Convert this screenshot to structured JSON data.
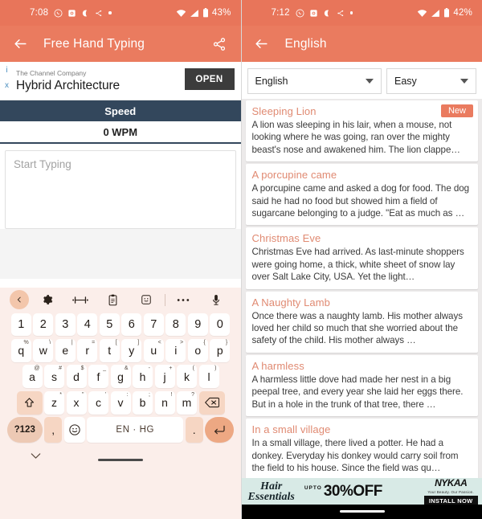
{
  "left": {
    "status": {
      "time": "7:08",
      "battery": "43%",
      "icons": [
        "whatsapp-icon",
        "camera-icon",
        "moon-icon",
        "bluetooth-share-icon",
        "dot-icon"
      ],
      "right_icons": [
        "wifi-icon",
        "signal-icon",
        "battery-icon"
      ]
    },
    "appbar": {
      "title": "Free Hand Typing",
      "back_icon": "arrow-back-icon",
      "share_icon": "share-icon"
    },
    "ad": {
      "advertiser": "The Channel Company",
      "headline": "Hybrid Architecture",
      "cta": "OPEN",
      "info_mark": "i",
      "close_mark": "x"
    },
    "speed": {
      "label": "Speed",
      "value": "0 WPM"
    },
    "input": {
      "placeholder": "Start Typing",
      "value": ""
    },
    "keyboard": {
      "toolbar": [
        "chevron-left-icon",
        "gear-icon",
        "cursor-move-icon",
        "clipboard-icon",
        "sticker-icon",
        "more-icon",
        "mic-icon"
      ],
      "number_row": [
        "1",
        "2",
        "3",
        "4",
        "5",
        "6",
        "7",
        "8",
        "9",
        "0"
      ],
      "row1": [
        {
          "k": "q",
          "sup": "%"
        },
        {
          "k": "w",
          "sup": "\\"
        },
        {
          "k": "e",
          "sup": "|"
        },
        {
          "k": "r",
          "sup": "="
        },
        {
          "k": "t",
          "sup": "["
        },
        {
          "k": "y",
          "sup": "]"
        },
        {
          "k": "u",
          "sup": "<"
        },
        {
          "k": "i",
          "sup": ">"
        },
        {
          "k": "o",
          "sup": "{"
        },
        {
          "k": "p",
          "sup": "}"
        }
      ],
      "row2": [
        {
          "k": "a",
          "sup": "@"
        },
        {
          "k": "s",
          "sup": "#"
        },
        {
          "k": "d",
          "sup": "$"
        },
        {
          "k": "f",
          "sup": "_"
        },
        {
          "k": "g",
          "sup": "&"
        },
        {
          "k": "h",
          "sup": "-"
        },
        {
          "k": "j",
          "sup": "+"
        },
        {
          "k": "k",
          "sup": "("
        },
        {
          "k": "l",
          "sup": ")"
        }
      ],
      "row3": [
        {
          "k": "z",
          "sup": "*"
        },
        {
          "k": "x",
          "sup": "\""
        },
        {
          "k": "c",
          "sup": "'"
        },
        {
          "k": "v",
          "sup": ":"
        },
        {
          "k": "b",
          "sup": ";"
        },
        {
          "k": "n",
          "sup": "!"
        },
        {
          "k": "m",
          "sup": "?"
        }
      ],
      "shift_icon": "shift-icon",
      "backspace_icon": "backspace-icon",
      "sym_key": "?123",
      "comma_key": ",",
      "period_key": ".",
      "emoji_icon": "emoji-icon",
      "space_label": "EN · HG",
      "enter_icon": "enter-icon",
      "hide_icon": "chevron-down-icon"
    }
  },
  "right": {
    "status": {
      "time": "7:12",
      "battery": "42%"
    },
    "appbar": {
      "title": "English",
      "back_icon": "arrow-back-icon"
    },
    "filters": {
      "language": "English",
      "difficulty": "Easy"
    },
    "stories": [
      {
        "title": "Sleeping Lion",
        "badge": "New",
        "body": "A lion was sleeping in his lair, when a mouse, not looking where he was going, ran over the mighty beast's nose and awakened him. The lion clappe…"
      },
      {
        "title": "A porcupine came",
        "badge": "",
        "body": "A porcupine came and asked a dog for food. The dog said he had no food but showed him a field of sugarcane belonging to a judge. \"Eat as much as …"
      },
      {
        "title": "Christmas Eve",
        "badge": "",
        "body": "Christmas Eve had arrived. As last-minute shoppers were going home, a thick, white sheet of snow lay over Salt Lake City, USA. Yet the light…"
      },
      {
        "title": "A Naughty Lamb",
        "badge": "",
        "body": "Once there was a naughty lamb. His mother always loved her child so much that she worried about the safety of the child. His mother always …"
      },
      {
        "title": "A harmless",
        "badge": "",
        "body": "A harmless little dove had made her nest in a big peepal tree, and every year she laid her eggs there. But in a hole in the trunk of that tree, there …"
      },
      {
        "title": "In a small village",
        "badge": "",
        "body": "In a small village, there lived a potter. He had a donkey. Everyday his donkey would carry soil from the field to his house. Since the field was qu…"
      }
    ],
    "banner": {
      "line1": "Hair",
      "line2": "Essentials",
      "upto": "UPTO",
      "offer": "30%OFF",
      "brand": "NYKAA",
      "tagline": "Your Beauty. Our Passion.",
      "cta": "INSTALL NOW"
    }
  },
  "colors": {
    "accent": "#ea7b5f",
    "dark_bar": "#33475c",
    "keyboard_bg": "#fbeeea",
    "story_title": "#e08a72",
    "banner_bg": "#d8eae6"
  }
}
